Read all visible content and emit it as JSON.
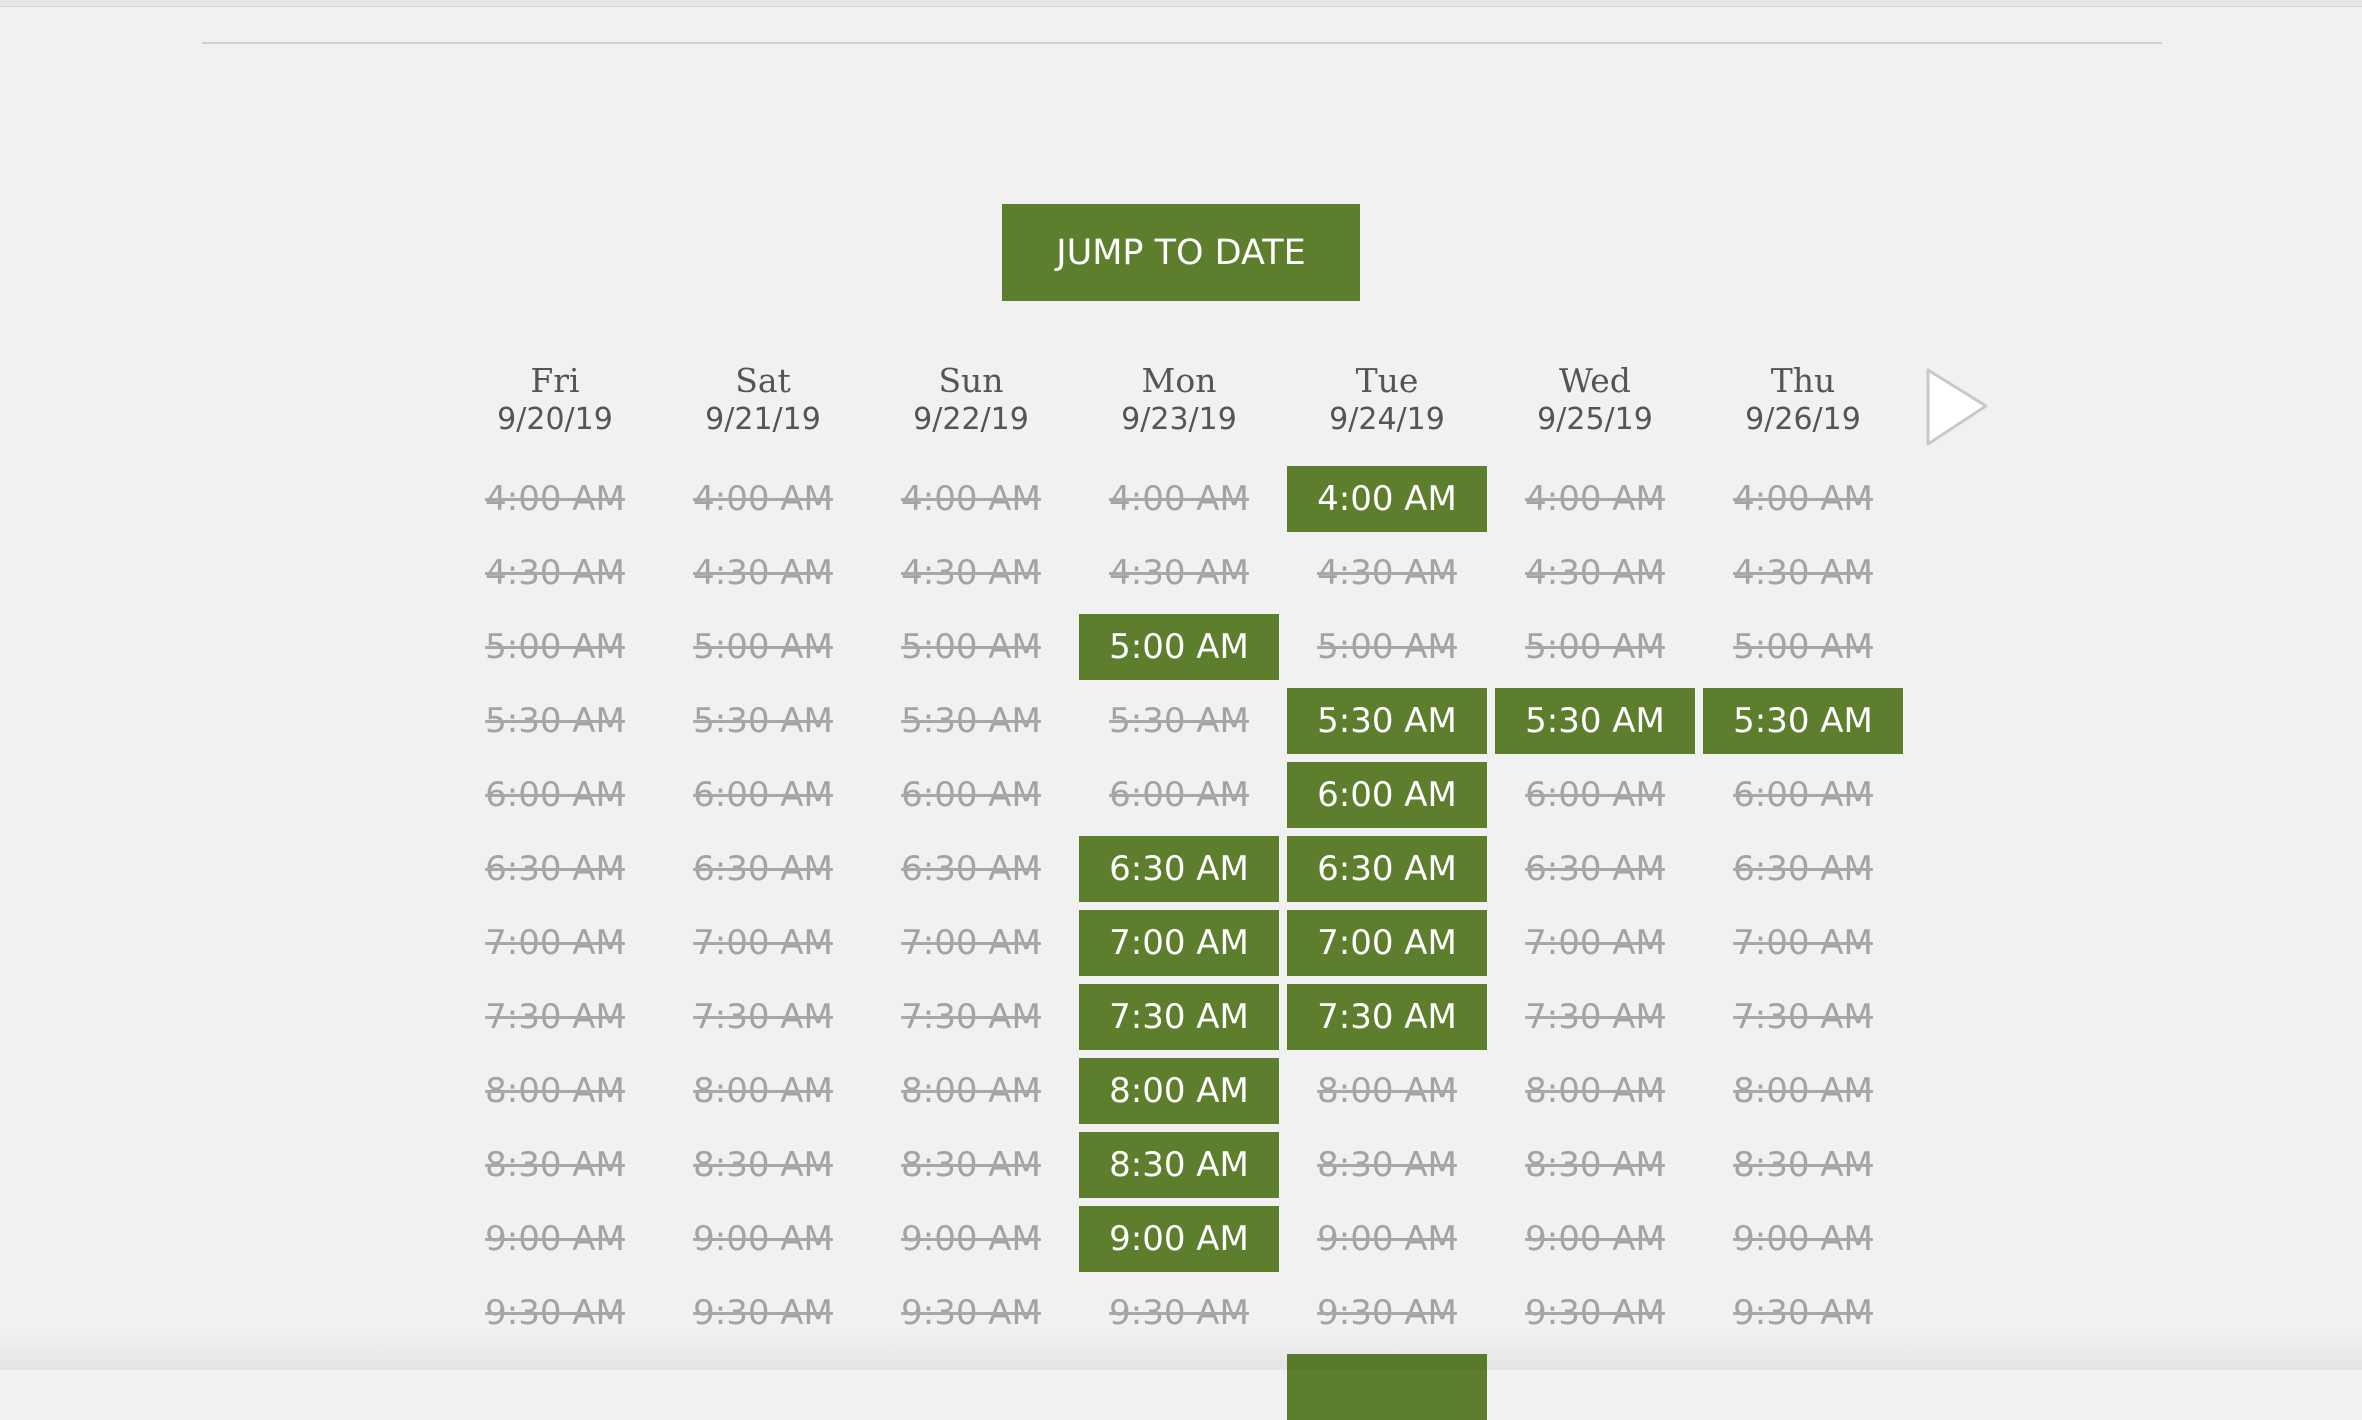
{
  "jump_button": {
    "label": "JUMP TO DATE"
  },
  "days": [
    {
      "name": "Fri",
      "date": "9/20/19"
    },
    {
      "name": "Sat",
      "date": "9/21/19"
    },
    {
      "name": "Sun",
      "date": "9/22/19"
    },
    {
      "name": "Mon",
      "date": "9/23/19"
    },
    {
      "name": "Tue",
      "date": "9/24/19"
    },
    {
      "name": "Wed",
      "date": "9/25/19"
    },
    {
      "name": "Thu",
      "date": "9/26/19"
    }
  ],
  "times": [
    "4:00 AM",
    "4:30 AM",
    "5:00 AM",
    "5:30 AM",
    "6:00 AM",
    "6:30 AM",
    "7:00 AM",
    "7:30 AM",
    "8:00 AM",
    "8:30 AM",
    "9:00 AM",
    "9:30 AM"
  ],
  "available": [
    [
      false,
      false,
      false,
      false,
      true,
      false,
      false
    ],
    [
      false,
      false,
      false,
      false,
      false,
      false,
      false
    ],
    [
      false,
      false,
      false,
      true,
      false,
      false,
      false
    ],
    [
      false,
      false,
      false,
      false,
      true,
      true,
      true
    ],
    [
      false,
      false,
      false,
      false,
      true,
      false,
      false
    ],
    [
      false,
      false,
      false,
      true,
      true,
      false,
      false
    ],
    [
      false,
      false,
      false,
      true,
      true,
      false,
      false
    ],
    [
      false,
      false,
      false,
      true,
      true,
      false,
      false
    ],
    [
      false,
      false,
      false,
      true,
      false,
      false,
      false
    ],
    [
      false,
      false,
      false,
      true,
      false,
      false,
      false
    ],
    [
      false,
      false,
      false,
      true,
      false,
      false,
      false
    ],
    [
      false,
      false,
      false,
      false,
      false,
      false,
      false
    ],
    [
      false,
      false,
      false,
      false,
      true,
      false,
      false
    ]
  ],
  "colors": {
    "accent": "#5d7f2d",
    "unavailable_text": "#a3a3a3",
    "background": "#f1f1f1"
  },
  "icons": {
    "next": "next-arrow-icon"
  }
}
